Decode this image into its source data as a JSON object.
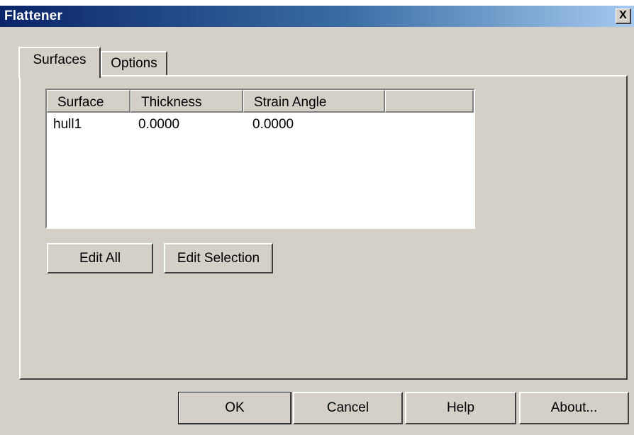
{
  "window": {
    "title": "Flattener",
    "close_label": "X"
  },
  "tabs": [
    {
      "label": "Surfaces",
      "selected": true
    },
    {
      "label": "Options",
      "selected": false
    }
  ],
  "surfaces_tab": {
    "columns": [
      "Surface",
      "Thickness",
      "Strain Angle",
      ""
    ],
    "rows": [
      {
        "surface": "hull1",
        "thickness": "0.0000",
        "strain_angle": "0.0000"
      }
    ],
    "buttons": {
      "edit_all": "Edit All",
      "edit_selection": "Edit Selection"
    }
  },
  "footer": {
    "ok": "OK",
    "cancel": "Cancel",
    "help": "Help",
    "about": "About..."
  }
}
